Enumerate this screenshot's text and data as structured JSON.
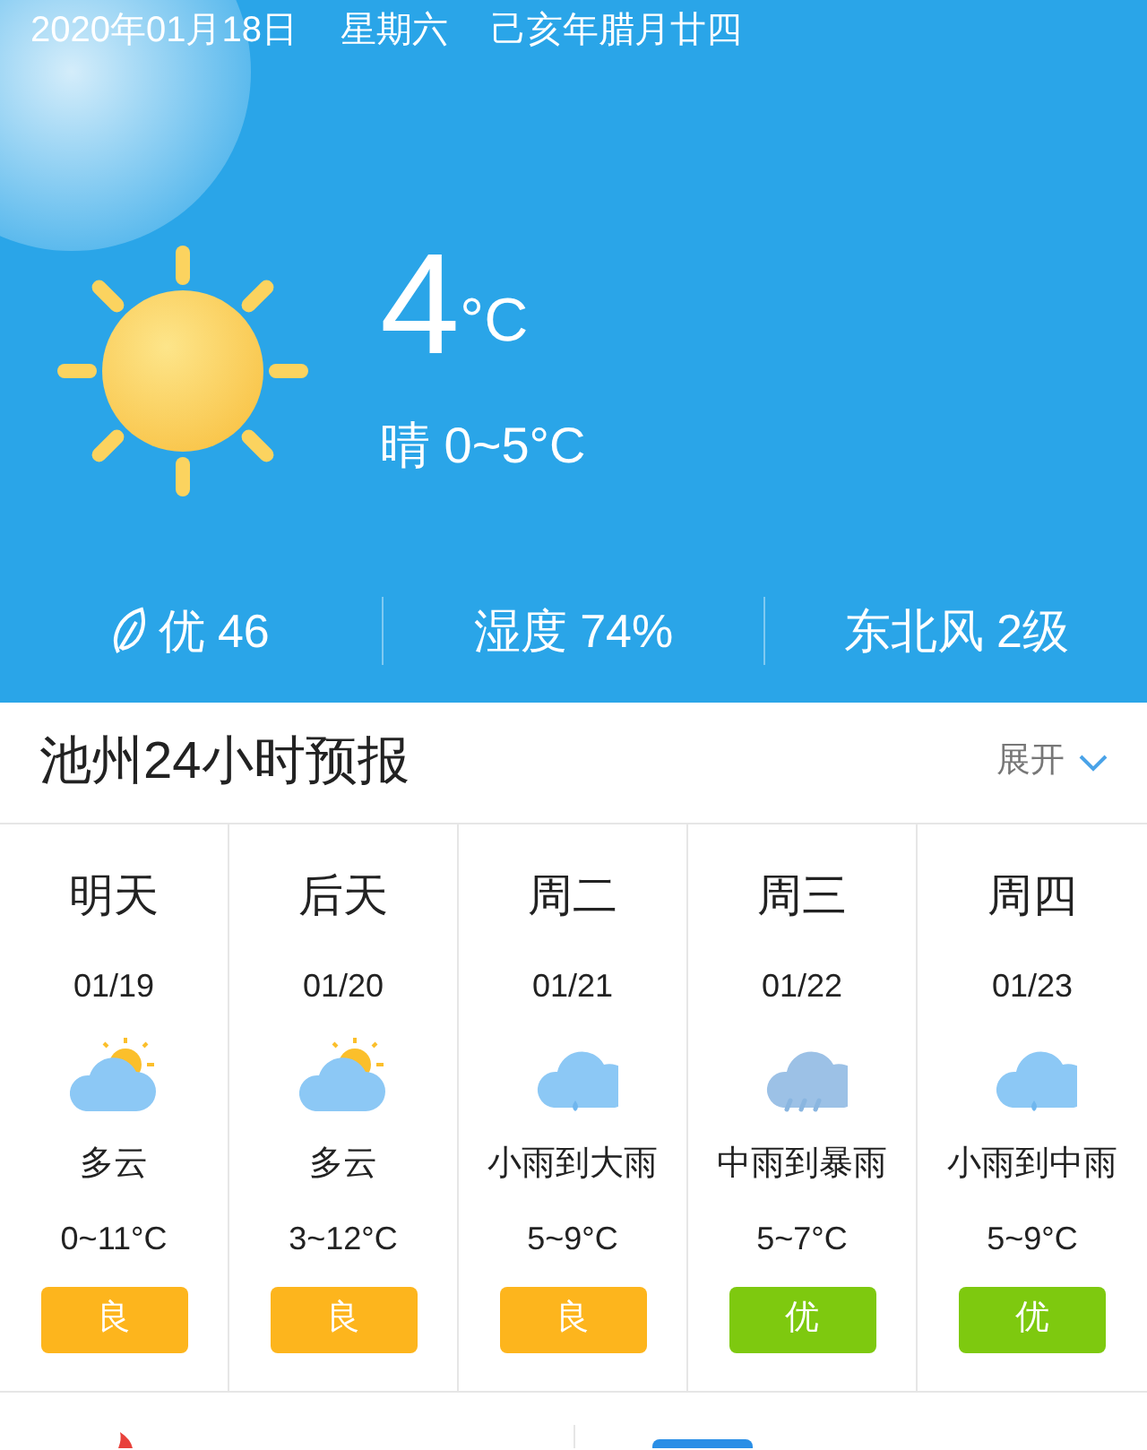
{
  "header": {
    "date": "2020年01月18日",
    "weekday": "星期六",
    "lunar_date": "己亥年腊月廿四"
  },
  "current": {
    "temperature": "4",
    "unit": "°C",
    "condition": "晴 0~5°C"
  },
  "stats": [
    {
      "kind": "air",
      "text": "优 46"
    },
    {
      "kind": "plain",
      "text": "湿度 74%"
    },
    {
      "kind": "plain",
      "text": "东北风 2级"
    }
  ],
  "forecast_section": {
    "title": "池州24小时预报",
    "expand": "展开"
  },
  "days": [
    {
      "day": "明天",
      "date": "01/19",
      "kind": "cloudy_sun",
      "condition": "多云",
      "temp": "0~11°C",
      "aqi": "良",
      "color": "#fdb51d"
    },
    {
      "day": "后天",
      "date": "01/20",
      "kind": "cloudy_sun",
      "condition": "多云",
      "temp": "3~12°C",
      "aqi": "良",
      "color": "#fdb51d"
    },
    {
      "day": "周二",
      "date": "01/21",
      "kind": "rain",
      "condition": "小雨到大雨",
      "temp": "5~9°C",
      "aqi": "良",
      "color": "#fdb51d"
    },
    {
      "day": "周三",
      "date": "01/22",
      "kind": "heavy_rain",
      "condition": "中雨到暴雨",
      "temp": "5~7°C",
      "aqi": "优",
      "color": "#7ec90f"
    },
    {
      "day": "周四",
      "date": "01/23",
      "kind": "rain",
      "condition": "小雨到中雨",
      "temp": "5~9°C",
      "aqi": "优",
      "color": "#7ec90f"
    }
  ]
}
